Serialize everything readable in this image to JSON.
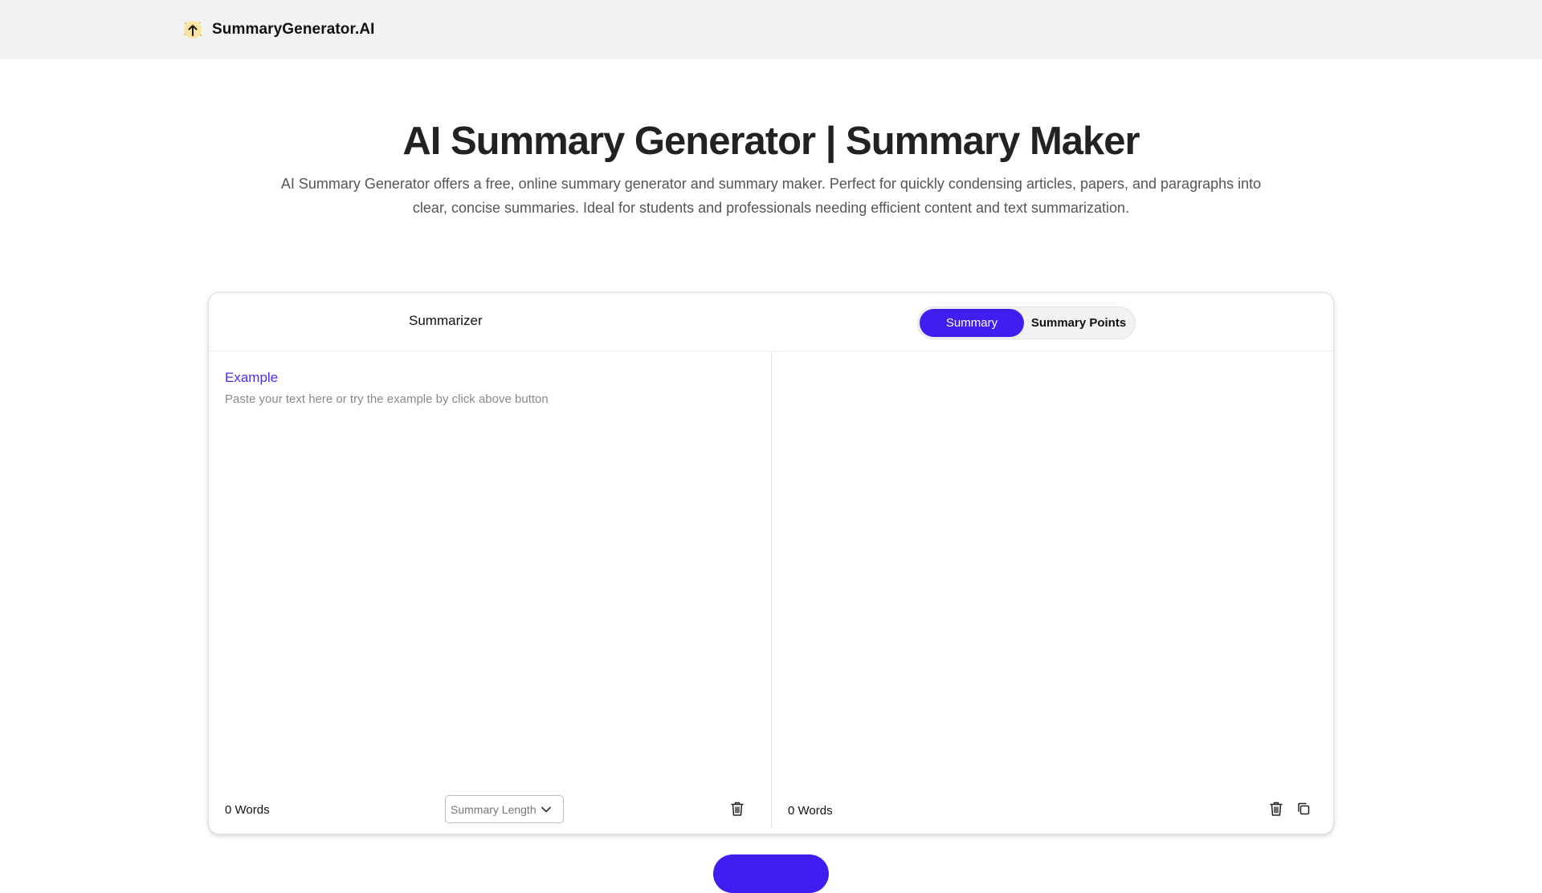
{
  "header": {
    "brand_name": "SummaryGenerator.AI",
    "logo_icon": "summary-logo-icon"
  },
  "hero": {
    "title": "AI Summary Generator | Summary Maker",
    "description": "AI Summary Generator offers a free, online summary generator and summary maker. Perfect for quickly condensing articles, papers, and paragraphs into clear, concise summaries. Ideal for students and professionals needing efficient content and text summarization."
  },
  "card": {
    "title": "Summarizer",
    "tabs": [
      {
        "label": "Summary",
        "active": true
      },
      {
        "label": "Summary Points",
        "active": false
      }
    ],
    "input": {
      "example_label": "Example",
      "placeholder": "Paste your text here or try the example by click above button",
      "value": "",
      "word_count": "0 Words",
      "length_select_label": "Summary Length"
    },
    "output": {
      "word_count": "0 Words"
    }
  },
  "colors": {
    "accent": "#3e1ff0",
    "link": "#4a2ef0",
    "header_bg": "#f2f2f2"
  }
}
